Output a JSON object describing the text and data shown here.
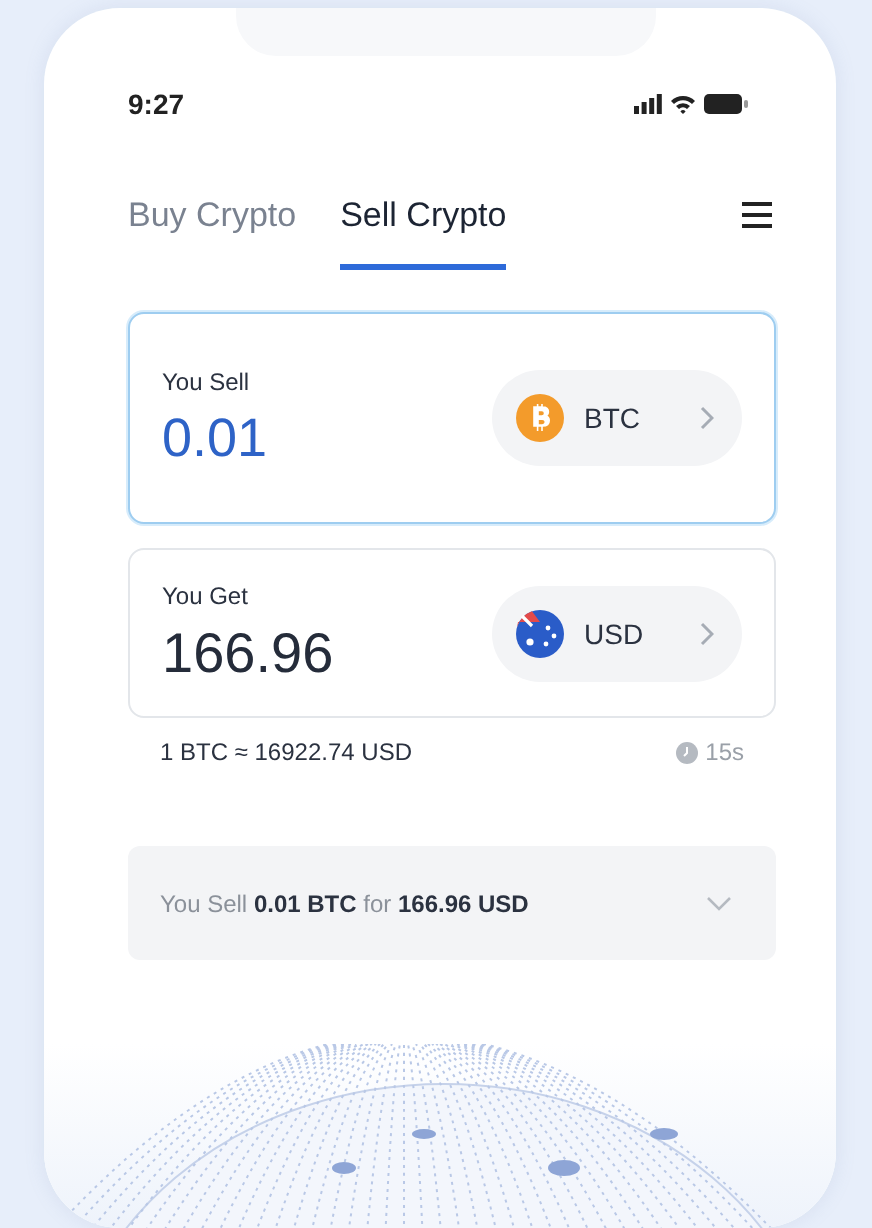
{
  "status_bar": {
    "time": "9:27"
  },
  "tabs": [
    {
      "label": "Buy Crypto",
      "selected": false
    },
    {
      "label": "Sell Crypto",
      "selected": true
    }
  ],
  "cards": [
    {
      "label": "You Sell",
      "amount": "0.01",
      "currency": "BTC",
      "kind": "bitcoin",
      "focused": true
    },
    {
      "label": "You Get",
      "amount": "166.96",
      "currency": "USD",
      "kind": "flag",
      "focused": false
    }
  ],
  "rate": {
    "text": "1 BTC ≈ 16922.74 USD",
    "timer": "15s"
  },
  "summary": {
    "text": "You Sell **0.01 BTC** for **166.96 USD**",
    "expanded": false
  }
}
